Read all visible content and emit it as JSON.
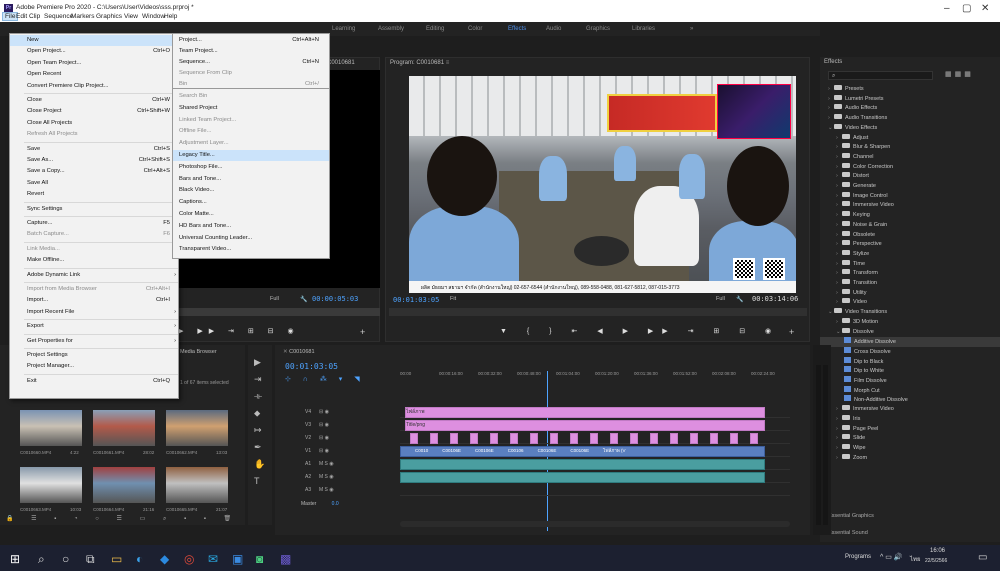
{
  "window": {
    "title": "Adobe Premiere Pro 2020 - C:\\Users\\User\\Videos\\sss.prproj *",
    "min": "–",
    "max": "▢",
    "close": "✕"
  },
  "menubar": [
    "File",
    "Edit",
    "Clip",
    "Sequence",
    "Markers",
    "Graphics",
    "View",
    "Window",
    "Help"
  ],
  "workspaces": [
    "Learning",
    "Assembly",
    "Editing",
    "Color",
    "Effects",
    "Audio",
    "Graphics",
    "Libraries",
    "»"
  ],
  "workspace_active": "Effects",
  "file_menu": [
    {
      "label": "New",
      "shortcut": "",
      "sel": true
    },
    {
      "label": "Open Project...",
      "shortcut": "Ctrl+O"
    },
    {
      "label": "Open Team Project...",
      "shortcut": ""
    },
    {
      "label": "Open Recent",
      "shortcut": ""
    },
    {
      "label": "Convert Premiere Clip Project...",
      "shortcut": ""
    },
    {
      "label": "Close",
      "shortcut": "Ctrl+W"
    },
    {
      "label": "Close Project",
      "shortcut": "Ctrl+Shift+W"
    },
    {
      "label": "Close All Projects",
      "shortcut": ""
    },
    {
      "label": "Refresh All Projects",
      "shortcut": "",
      "dis": true
    },
    {
      "label": "Save",
      "shortcut": "Ctrl+S"
    },
    {
      "label": "Save As...",
      "shortcut": "Ctrl+Shift+S"
    },
    {
      "label": "Save a Copy...",
      "shortcut": "Ctrl+Alt+S"
    },
    {
      "label": "Save All",
      "shortcut": ""
    },
    {
      "label": "Revert",
      "shortcut": ""
    },
    {
      "label": "Sync Settings",
      "shortcut": ""
    },
    {
      "label": "Capture...",
      "shortcut": "F5"
    },
    {
      "label": "Batch Capture...",
      "shortcut": "F6",
      "dis": true
    },
    {
      "label": "Link Media...",
      "shortcut": "",
      "dis": true
    },
    {
      "label": "Make Offline...",
      "shortcut": ""
    },
    {
      "label": "Adobe Dynamic Link",
      "shortcut": ""
    },
    {
      "label": "Import from Media Browser",
      "shortcut": "Ctrl+Alt+I",
      "dis": true
    },
    {
      "label": "Import...",
      "shortcut": "Ctrl+I"
    },
    {
      "label": "Import Recent File",
      "shortcut": ""
    },
    {
      "label": "Export",
      "shortcut": ""
    },
    {
      "label": "Get Properties for",
      "shortcut": ""
    },
    {
      "label": "Project Settings",
      "shortcut": ""
    },
    {
      "label": "Project Manager...",
      "shortcut": ""
    },
    {
      "label": "Exit",
      "shortcut": "Ctrl+Q"
    }
  ],
  "new_submenu": [
    {
      "label": "Project...",
      "shortcut": "Ctrl+Alt+N"
    },
    {
      "label": "Team Project...",
      "shortcut": ""
    },
    {
      "label": "Sequence...",
      "shortcut": "Ctrl+N"
    },
    {
      "label": "Sequence From Clip",
      "shortcut": "",
      "dis": true
    },
    {
      "label": "Bin",
      "shortcut": "Ctrl+/",
      "dis": true
    }
  ],
  "new_submenu2": [
    {
      "label": "Search Bin",
      "dis": true
    },
    {
      "label": "Shared Project"
    },
    {
      "label": "Linked Team Project...",
      "dis": true
    },
    {
      "label": "Offline File...",
      "dis": true
    },
    {
      "label": "Adjustment Layer...",
      "dis": true
    },
    {
      "label": "Legacy Title...",
      "sel": true
    },
    {
      "label": "Photoshop File..."
    },
    {
      "label": "Bars and Tone..."
    },
    {
      "label": "Black Video..."
    },
    {
      "label": "Captions..."
    },
    {
      "label": "Color Matte..."
    },
    {
      "label": "HD Bars and Tone..."
    },
    {
      "label": "Universal Counting Leader..."
    },
    {
      "label": "Transparent Video..."
    }
  ],
  "source": {
    "tab": "C0010681",
    "fit": "Full",
    "timecode": "00:00:05:03"
  },
  "program": {
    "tab": "Program: C0010681",
    "timecode": "00:01:03:05",
    "fit": "Fit",
    "full": "Full",
    "duration": "00:03:14:06",
    "caption": "ผลิต มัธยมฯ สยามฯ จำกัด (สำนักงานใหญ่)  02-657-6544 (สำนักงานใหญ่), 089-558-0488, 081-627-5812, 087-015-3773"
  },
  "effects": {
    "title": "Effects",
    "tree": [
      {
        "label": "Presets",
        "lvl": 0
      },
      {
        "label": "Lumetri Presets",
        "lvl": 0
      },
      {
        "label": "Audio Effects",
        "lvl": 0
      },
      {
        "label": "Audio Transitions",
        "lvl": 0
      },
      {
        "label": "Video Effects",
        "lvl": 0,
        "open": true
      },
      {
        "label": "Adjust",
        "lvl": 1
      },
      {
        "label": "Blur & Sharpen",
        "lvl": 1
      },
      {
        "label": "Channel",
        "lvl": 1
      },
      {
        "label": "Color Correction",
        "lvl": 1
      },
      {
        "label": "Distort",
        "lvl": 1
      },
      {
        "label": "Generate",
        "lvl": 1
      },
      {
        "label": "Image Control",
        "lvl": 1
      },
      {
        "label": "Immersive Video",
        "lvl": 1
      },
      {
        "label": "Keying",
        "lvl": 1
      },
      {
        "label": "Noise & Grain",
        "lvl": 1
      },
      {
        "label": "Obsolete",
        "lvl": 1
      },
      {
        "label": "Perspective",
        "lvl": 1
      },
      {
        "label": "Stylize",
        "lvl": 1
      },
      {
        "label": "Time",
        "lvl": 1
      },
      {
        "label": "Transform",
        "lvl": 1
      },
      {
        "label": "Transition",
        "lvl": 1
      },
      {
        "label": "Utility",
        "lvl": 1
      },
      {
        "label": "Video",
        "lvl": 1
      },
      {
        "label": "Video Transitions",
        "lvl": 0,
        "open": true
      },
      {
        "label": "3D Motion",
        "lvl": 1
      },
      {
        "label": "Dissolve",
        "lvl": 1,
        "open": true
      },
      {
        "label": "Additive Dissolve",
        "lvl": 2,
        "fx": true,
        "hl": true
      },
      {
        "label": "Cross Dissolve",
        "lvl": 2,
        "fx": true
      },
      {
        "label": "Dip to Black",
        "lvl": 2,
        "fx": true
      },
      {
        "label": "Dip to White",
        "lvl": 2,
        "fx": true
      },
      {
        "label": "Film Dissolve",
        "lvl": 2,
        "fx": true
      },
      {
        "label": "Morph Cut",
        "lvl": 2,
        "fx": true
      },
      {
        "label": "Non-Additive Dissolve",
        "lvl": 2,
        "fx": true
      },
      {
        "label": "Immersive Video",
        "lvl": 1
      },
      {
        "label": "Iris",
        "lvl": 1
      },
      {
        "label": "Page Peel",
        "lvl": 1
      },
      {
        "label": "Slide",
        "lvl": 1
      },
      {
        "label": "Wipe",
        "lvl": 1
      },
      {
        "label": "Zoom",
        "lvl": 1
      }
    ],
    "essential_graphics": "Essential Graphics",
    "essential_sound": "Essential Sound"
  },
  "project": {
    "tab": "Media Browser",
    "count": "1 of 67 items selected",
    "thumbs": [
      {
        "name": "C0010660.MP4",
        "dur": "4:22"
      },
      {
        "name": "C0010661.MP4",
        "dur": "28:02"
      },
      {
        "name": "C0010662.MP4",
        "dur": "13:03"
      },
      {
        "name": "C0010663.MP4",
        "dur": "10:03"
      },
      {
        "name": "C0010664.MP4",
        "dur": "21:16"
      },
      {
        "name": "C0010665.MP4",
        "dur": "21:07"
      }
    ]
  },
  "timeline": {
    "tab": "C0010681",
    "timecode": "00:01:03:05",
    "ruler": [
      "00:00",
      "00:00:16:00",
      "00:00:32:00",
      "00:00:48:00",
      "00:01:04:00",
      "00:01:20:00",
      "00:01:36:00",
      "00:01:52:00",
      "00:02:08:00",
      "00:02:24:00"
    ],
    "tracks": [
      "V4",
      "V3",
      "V2",
      "V1",
      "A1",
      "A2",
      "A3"
    ],
    "master": "Master",
    "master_val": "0.0",
    "clip_v4": "ไฟล์ภาพ",
    "clip_v3": "Title/png",
    "v1_clips": [
      "C0010",
      "C00106E",
      "C00106E",
      "C00106",
      "C00106E",
      "C00106E",
      "ไฟล์ภาพ (V"
    ]
  },
  "taskbar": {
    "programs": "Programs",
    "time": "16:06",
    "date": "22/5/2566",
    "lang": "ไทย"
  }
}
